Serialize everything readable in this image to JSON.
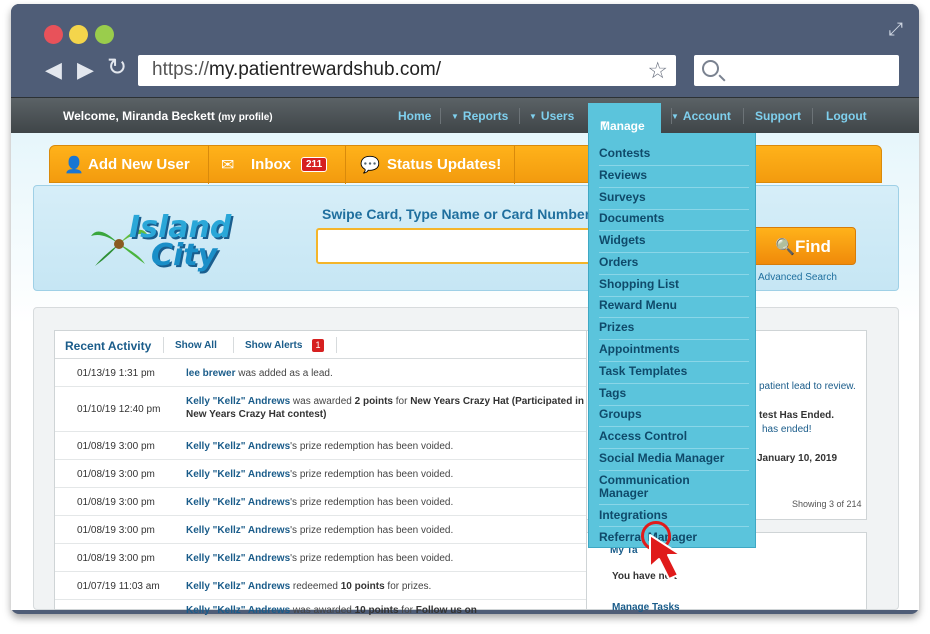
{
  "browser": {
    "url_protocol": "https://",
    "url_domain": "my.patientrewardshub.com/",
    "back_icon": "back-arrow-icon",
    "forward_icon": "forward-arrow-icon",
    "reload_icon": "reload-icon"
  },
  "topnav": {
    "welcome": "Welcome, Miranda Beckett",
    "my_profile": "(my profile)",
    "items": [
      "Home",
      "Reports",
      "Users",
      "Manage",
      "Account",
      "Support",
      "Logout"
    ]
  },
  "tabs": {
    "add_user": "Add New User",
    "inbox": "Inbox",
    "inbox_count": "211",
    "status_updates": "Status Updates!"
  },
  "search": {
    "logo_line1": "Island",
    "logo_line2": "City",
    "label": "Swipe Card, Type Name or Card Number",
    "find": "Find",
    "advanced": "Advanced Search"
  },
  "activity": {
    "title": "Recent Activity",
    "show_all": "Show All",
    "show_alerts": "Show Alerts",
    "alerts_count": "1",
    "rows": [
      {
        "date": "01/13/19 1:31 pm",
        "name": "lee brewer",
        "text": " was added as a lead."
      },
      {
        "date": "01/10/19 12:40 pm",
        "name": "Kelly \"Kellz\" Andrews",
        "text": " was awarded ",
        "bold1": "2 points",
        "text2": " for ",
        "bold2": "New Years Crazy Hat (Participated in New Years Crazy Hat contest)"
      },
      {
        "date": "01/08/19 3:00 pm",
        "name": "Kelly \"Kellz\" Andrews",
        "text": "'s prize redemption has been voided."
      },
      {
        "date": "01/08/19 3:00 pm",
        "name": "Kelly \"Kellz\" Andrews",
        "text": "'s prize redemption has been voided."
      },
      {
        "date": "01/08/19 3:00 pm",
        "name": "Kelly \"Kellz\" Andrews",
        "text": "'s prize redemption has been voided."
      },
      {
        "date": "01/08/19 3:00 pm",
        "name": "Kelly \"Kellz\" Andrews",
        "text": "'s prize redemption has been voided."
      },
      {
        "date": "01/08/19 3:00 pm",
        "name": "Kelly \"Kellz\" Andrews",
        "text": "'s prize redemption has been voided."
      },
      {
        "date": "01/07/19 11:03 am",
        "name": "Kelly \"Kellz\" Andrews",
        "text": " redeemed ",
        "bold1": "10 points",
        "text2": " for prizes."
      },
      {
        "date": "",
        "name": "Kelly \"Kellz\" Andrews",
        "text": " was awarded ",
        "bold1": "10 points",
        "text2": " for ",
        "bold2": "Follow us on"
      }
    ]
  },
  "right_panel": {
    "lead_text": "patient lead to review.",
    "contest_text": "test Has Ended.",
    "contest_link": "has ended!",
    "date_text": "January 10, 2019",
    "showing": "Showing 3 of 214",
    "my_tasks_label": "My Ta",
    "no_tasks": "You have no t",
    "manage_tasks": "Manage Tasks"
  },
  "manage_menu": [
    "Contests",
    "Reviews",
    "Surveys",
    "Documents",
    "Widgets",
    "Orders",
    "Shopping List",
    "Reward Menu",
    "Prizes",
    "Appointments",
    "Task Templates",
    "Tags",
    "Groups",
    "Access Control",
    "Social Media Manager",
    "Communication Manager",
    "Integrations",
    "Referral Manager"
  ]
}
